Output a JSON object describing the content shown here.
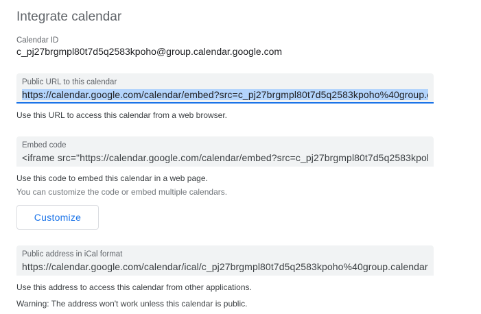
{
  "section": {
    "title": "Integrate calendar"
  },
  "calendar_id": {
    "label": "Calendar ID",
    "value": "c_pj27brgmpl80t7d5q2583kpoho@group.calendar.google.com"
  },
  "public_url": {
    "label": "Public URL to this calendar",
    "value": "https://calendar.google.com/calendar/embed?src=c_pj27brgmpl80t7d5q2583kpoho%40group.c",
    "helper": "Use this URL to access this calendar from a web browser."
  },
  "embed_code": {
    "label": "Embed code",
    "value": "<iframe src=\"https://calendar.google.com/calendar/embed?src=c_pj27brgmpl80t7d5q2583kpol",
    "helper": "Use this code to embed this calendar in a web page.",
    "helper_secondary": "You can customize the code or embed multiple calendars."
  },
  "customize_button": {
    "label": "Customize"
  },
  "ical": {
    "label": "Public address in iCal format",
    "value": "https://calendar.google.com/calendar/ical/c_pj27brgmpl80t7d5q2583kpoho%40group.calendar",
    "helper": "Use this address to access this calendar from other applications.",
    "warning": "Warning: The address won't work unless this calendar is public."
  },
  "colors": {
    "accent": "#1a73e8",
    "field_bg": "#f1f3f4",
    "selection": "#b3d4fc"
  }
}
